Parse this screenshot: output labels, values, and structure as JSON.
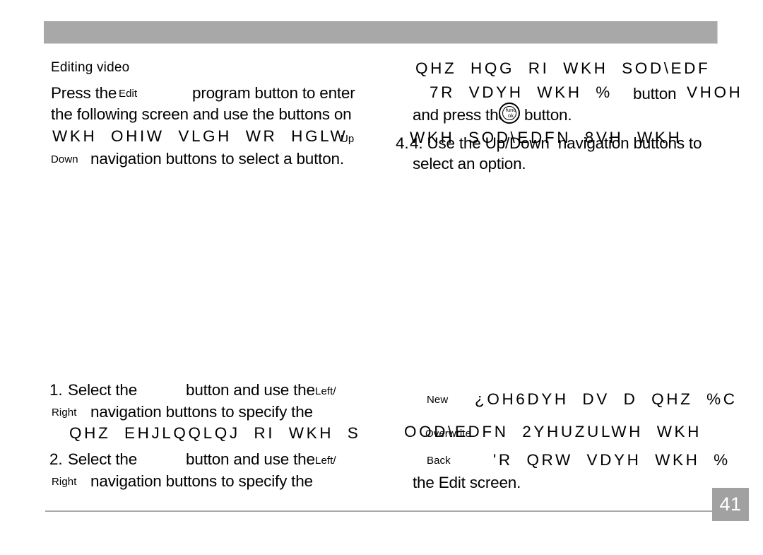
{
  "page": {
    "number": "41",
    "header_bar_color": "#a8a8a8",
    "badge_color": "#a1a1a1",
    "rule_color": "#a9a9a9",
    "text_color": "#000000",
    "background_color": "#ffffff"
  },
  "left_column": {
    "heading": "Editing video",
    "intro": {
      "line1_a": "Press the",
      "line1_label": "Edit",
      "line1_b": "program button to enter",
      "line2": "the following screen and use the buttons on",
      "line3_cipher": "WKH  OHIW  VLGH  WR  HGLW",
      "line3_label": "Up",
      "line3_trailing": "4.",
      "line4_label": "Down",
      "line4_b": "navigation buttons to select a button."
    },
    "steps": [
      {
        "number": "1.",
        "text_a": "Select the",
        "text_b": "button and use the",
        "label_inline": "Left/",
        "label_next": "Right",
        "text_c": "navigation buttons to specify the",
        "cipher_line": "QHZ  EHJLQQLQJ  RI  WKH  S"
      },
      {
        "number": "2.",
        "text_a": "Select the",
        "text_b": "button and use the",
        "label_inline": "Left/",
        "label_next": "Right",
        "text_c": "navigation buttons to specify the"
      }
    ]
  },
  "right_column": {
    "top": {
      "cipher_line1": "QHZ  HQG  RI  WKH  SOD\\EDF",
      "cipher_line2": "7R  VDYH  WKH  %",
      "overlay_line2": "button",
      "cipher_line2_tail": "VHOH",
      "line3_a": "and press the",
      "line3_b": "button.",
      "cipher_line4": "WKH  SOD\\EDFN  8VH  WKH",
      "overlay_line4": "4. Use the Up/Down  navigation buttons to",
      "line5": "select an option."
    },
    "options": [
      {
        "label": "New",
        "cipher": "¿OH6DYH  DV  D  QHZ  %C"
      },
      {
        "label": "Overwrite",
        "cipher": "OOD\\EDFN  2YHUZULWH  WKH"
      },
      {
        "label": "Back",
        "cipher": "'R  QRW  VDYH  WKH  %"
      }
    ],
    "closing_line": "the Edit screen."
  },
  "icons": {
    "funcok": {
      "name": "func-ok-button-icon",
      "top_text": "func",
      "bottom_text": "ok"
    }
  }
}
